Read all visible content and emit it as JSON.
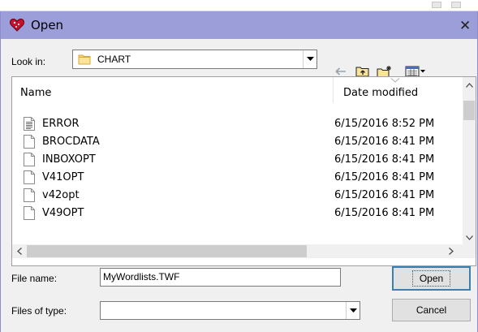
{
  "dialog": {
    "title": "Open",
    "close_glyph": "✕"
  },
  "look_in": {
    "label": "Look in:",
    "value": "CHART",
    "icon": "folder-icon"
  },
  "toolbar": {
    "back": "back-arrow-icon",
    "up_folder": "up-folder-icon",
    "new_folder": "new-folder-icon",
    "view_menu": "view-menu-icon"
  },
  "list": {
    "columns": {
      "name": "Name",
      "date": "Date modified"
    },
    "rows": [
      {
        "name": "ERROR",
        "date": "6/15/2016 8:52 PM",
        "icon": "text-file-icon"
      },
      {
        "name": "BROCDATA",
        "date": "6/15/2016 8:41 PM",
        "icon": "blank-file-icon"
      },
      {
        "name": "INBOXOPT",
        "date": "6/15/2016 8:41 PM",
        "icon": "blank-file-icon"
      },
      {
        "name": "V41OPT",
        "date": "6/15/2016 8:41 PM",
        "icon": "blank-file-icon"
      },
      {
        "name": "v42opt",
        "date": "6/15/2016 8:41 PM",
        "icon": "blank-file-icon"
      },
      {
        "name": "V49OPT",
        "date": "6/15/2016 8:41 PM",
        "icon": "blank-file-icon"
      }
    ]
  },
  "file_name": {
    "label": "File name:",
    "value": "MyWordlists.TWF"
  },
  "file_type": {
    "label": "Files of type:",
    "value": ""
  },
  "buttons": {
    "open": "Open",
    "cancel": "Cancel"
  },
  "colors": {
    "titlebar": "#9b9ed8",
    "window_border": "#8c8cc8",
    "default_button_border": "#3c7fb1"
  }
}
